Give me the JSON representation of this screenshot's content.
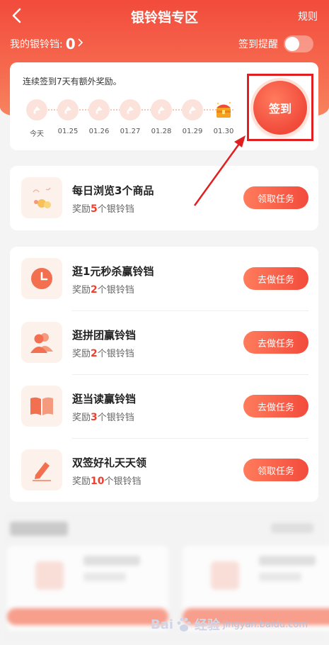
{
  "header": {
    "title": "银铃铛专区",
    "rules_label": "规则",
    "balance_label": "我的银铃铛:",
    "balance_value": "0",
    "reminder_label": "签到提醒",
    "reminder_on": false
  },
  "signin": {
    "hint": "连续签到7天有额外奖励。",
    "button_label": "签到",
    "days": [
      {
        "label": "今天",
        "icon": "bell-icon"
      },
      {
        "label": "01.25",
        "icon": "bell-icon"
      },
      {
        "label": "01.26",
        "icon": "bell-icon"
      },
      {
        "label": "01.27",
        "icon": "bell-icon"
      },
      {
        "label": "01.28",
        "icon": "bell-icon"
      },
      {
        "label": "01.29",
        "icon": "bell-icon"
      },
      {
        "label": "01.30",
        "icon": "treasure-chest-icon"
      }
    ]
  },
  "daily_task": {
    "title": "每日浏览3个商品",
    "reward_prefix": "奖励",
    "reward_num": "5",
    "reward_suffix": "个银铃铛",
    "button_label": "领取任务",
    "icon": "gift-coins-icon"
  },
  "tasks": [
    {
      "title": "逛1元秒杀赢铃铛",
      "reward_prefix": "奖励",
      "reward_num": "2",
      "reward_suffix": "个银铃铛",
      "button_label": "去做任务",
      "icon": "clock-icon"
    },
    {
      "title": "逛拼团赢铃铛",
      "reward_prefix": "奖励",
      "reward_num": "2",
      "reward_suffix": "个银铃铛",
      "button_label": "去做任务",
      "icon": "users-icon"
    },
    {
      "title": "逛当读赢铃铛",
      "reward_prefix": "奖励",
      "reward_num": "3",
      "reward_suffix": "个银铃铛",
      "button_label": "去做任务",
      "icon": "book-icon"
    },
    {
      "title": "双签好礼天天领",
      "reward_prefix": "奖励",
      "reward_num": "10",
      "reward_suffix": "个银铃铛",
      "button_label": "领取任务",
      "icon": "pencil-icon"
    }
  ],
  "watermark": {
    "brand": "Bai",
    "brand_end": "经验",
    "sub": "jingyan.baidu.com"
  },
  "colors": {
    "accent": "#f24b3c",
    "accent_light": "#ff7c5c",
    "highlight_box": "#e02020"
  }
}
